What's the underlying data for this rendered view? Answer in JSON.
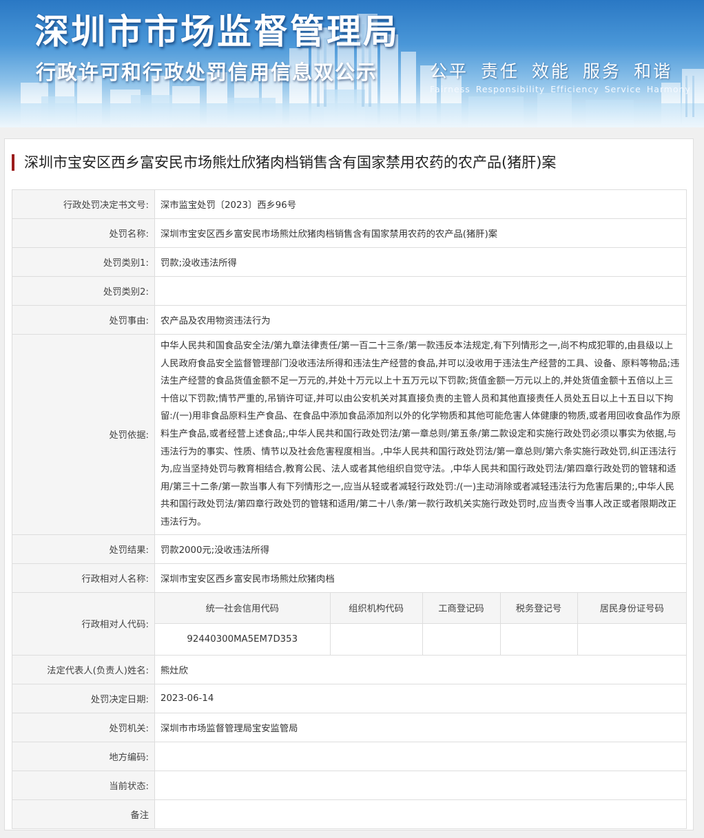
{
  "header": {
    "agency_title": "深圳市市场监督管理局",
    "system_title": "行政许可和行政处罚信用信息双公示",
    "motto_cn": [
      "公平",
      "责任",
      "效能",
      "服务",
      "和谐"
    ],
    "motto_en": [
      "Fairness",
      "Responsibility",
      "Efficiency",
      "Service",
      "Harmony"
    ]
  },
  "case": {
    "title": "深圳市宝安区西乡富安民市场熊灶欣猪肉档销售含有国家禁用农药的农产品(猪肝)案"
  },
  "fields": {
    "decision_no": {
      "label": "行政处罚决定书文号:",
      "value": "深市监宝处罚〔2023〕西乡96号"
    },
    "penalty_name": {
      "label": "处罚名称:",
      "value": "深圳市宝安区西乡富安民市场熊灶欣猪肉档销售含有国家禁用农药的农产品(猪肝)案"
    },
    "category1": {
      "label": "处罚类别1:",
      "value": "罚款;没收违法所得"
    },
    "category2": {
      "label": "处罚类别2:",
      "value": ""
    },
    "reason": {
      "label": "处罚事由:",
      "value": "农产品及农用物资违法行为"
    },
    "basis": {
      "label": "处罚依据:",
      "value": "中华人民共和国食品安全法/第九章法律责任/第一百二十三条/第一款违反本法规定,有下列情形之一,尚不构成犯罪的,由县级以上人民政府食品安全监督管理部门没收违法所得和违法生产经营的食品,并可以没收用于违法生产经营的工具、设备、原料等物品;违法生产经营的食品货值金额不足一万元的,并处十万元以上十五万元以下罚款;货值金额一万元以上的,并处货值金额十五倍以上三十倍以下罚款;情节严重的,吊销许可证,并可以由公安机关对其直接负责的主管人员和其他直接责任人员处五日以上十五日以下拘留:/(一)用非食品原料生产食品、在食品中添加食品添加剂以外的化学物质和其他可能危害人体健康的物质,或者用回收食品作为原料生产食品,或者经营上述食品;,中华人民共和国行政处罚法/第一章总则/第五条/第二款设定和实施行政处罚必须以事实为依据,与违法行为的事实、性质、情节以及社会危害程度相当。,中华人民共和国行政处罚法/第一章总则/第六条实施行政处罚,纠正违法行为,应当坚持处罚与教育相结合,教育公民、法人或者其他组织自觉守法。,中华人民共和国行政处罚法/第四章行政处罚的管辖和适用/第三十二条/第一款当事人有下列情形之一,应当从轻或者减轻行政处罚:/(一)主动消除或者减轻违法行为危害后果的;,中华人民共和国行政处罚法/第四章行政处罚的管辖和适用/第二十八条/第一款行政机关实施行政处罚时,应当责令当事人改正或者限期改正违法行为。"
    },
    "result": {
      "label": "处罚结果:",
      "value": "罚款2000元;没收违法所得"
    },
    "party_name": {
      "label": "行政相对人名称:",
      "value": "深圳市宝安区西乡富安民市场熊灶欣猪肉档"
    },
    "party_code": {
      "label": "行政相对人代码:",
      "headers": [
        "统一社会信用代码",
        "组织机构代码",
        "工商登记码",
        "税务登记号",
        "居民身份证号码"
      ],
      "values": [
        "92440300MA5EM7D353",
        "",
        "",
        "",
        ""
      ]
    },
    "legal_rep": {
      "label": "法定代表人(负责人)姓名:",
      "value": "熊灶欣"
    },
    "decision_date": {
      "label": "处罚决定日期:",
      "value": "2023-06-14"
    },
    "authority": {
      "label": "处罚机关:",
      "value": "深圳市市场监督管理局宝安监管局"
    },
    "region_code": {
      "label": "地方编码:",
      "value": ""
    },
    "status": {
      "label": "当前状态:",
      "value": ""
    },
    "remark": {
      "label": "备注",
      "value": ""
    }
  }
}
